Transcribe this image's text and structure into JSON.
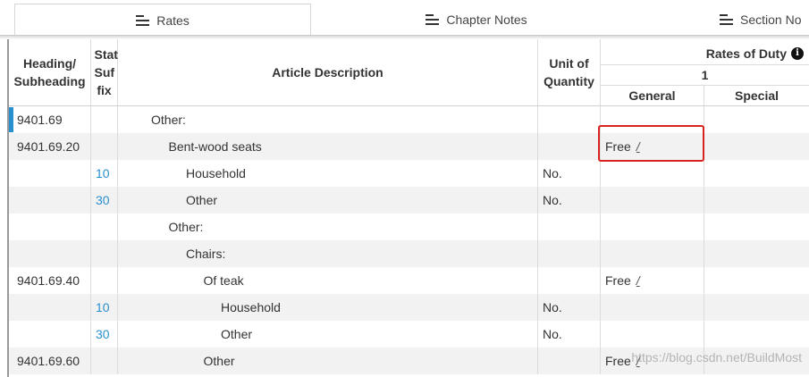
{
  "tabs": [
    {
      "label": "Rates",
      "icon": "list-icon",
      "active": true
    },
    {
      "label": "Chapter Notes",
      "icon": "list-icon",
      "active": false
    },
    {
      "label": "Section No",
      "icon": "list-icon",
      "active": false
    }
  ],
  "columns": {
    "heading": "Heading/ Subheading",
    "stat_suffix": "Stat Suf fix",
    "article_description": "Article Description",
    "unit_of_quantity": "Unit of Quantity",
    "rates_of_duty": "Rates of Duty",
    "rate_column_number": "1",
    "general": "General",
    "special": "Special"
  },
  "rows": [
    {
      "heading": "9401.69",
      "suffix": "",
      "description": "Other:",
      "indent": 0,
      "unit": "",
      "general": "",
      "general_link": "",
      "special": ""
    },
    {
      "heading": "9401.69.20",
      "suffix": "",
      "description": "Bent-wood seats",
      "indent": 1,
      "unit": "",
      "general": "Free",
      "general_link": "/",
      "special": ""
    },
    {
      "heading": "",
      "suffix": "10",
      "description": "Household",
      "indent": 2,
      "unit": "No.",
      "general": "",
      "general_link": "",
      "special": ""
    },
    {
      "heading": "",
      "suffix": "30",
      "description": "Other",
      "indent": 2,
      "unit": "No.",
      "general": "",
      "general_link": "",
      "special": ""
    },
    {
      "heading": "",
      "suffix": "",
      "description": "Other:",
      "indent": 1,
      "unit": "",
      "general": "",
      "general_link": "",
      "special": ""
    },
    {
      "heading": "",
      "suffix": "",
      "description": "Chairs:",
      "indent": 2,
      "unit": "",
      "general": "",
      "general_link": "",
      "special": ""
    },
    {
      "heading": "9401.69.40",
      "suffix": "",
      "description": "Of teak",
      "indent": 3,
      "unit": "",
      "general": "Free",
      "general_link": "/",
      "special": ""
    },
    {
      "heading": "",
      "suffix": "10",
      "description": "Household",
      "indent": 4,
      "unit": "No.",
      "general": "",
      "general_link": "",
      "special": ""
    },
    {
      "heading": "",
      "suffix": "30",
      "description": "Other",
      "indent": 4,
      "unit": "No.",
      "general": "",
      "general_link": "",
      "special": ""
    },
    {
      "heading": "9401.69.60",
      "suffix": "",
      "description": "Other",
      "indent": 3,
      "unit": "",
      "general": "Free",
      "general_link": "/",
      "special": ""
    }
  ],
  "watermark": "https://blog.csdn.net/BuildMost",
  "colors": {
    "accent": "#2a8fcf",
    "highlight": "#d9231f",
    "alt_row": "#f2f2f2"
  }
}
